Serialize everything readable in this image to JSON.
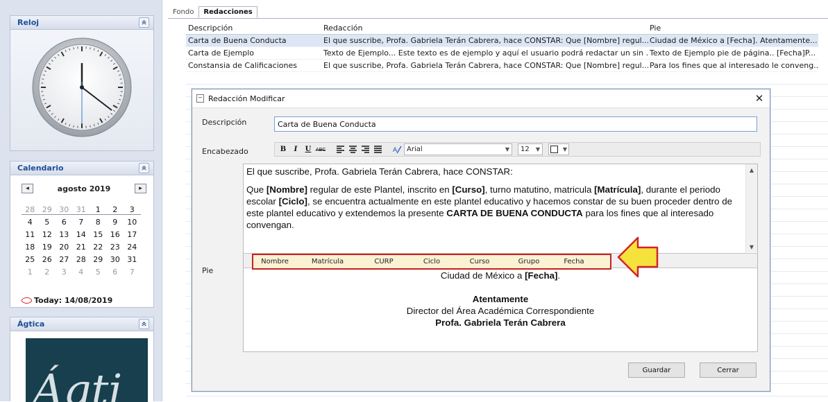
{
  "clock_widget": {
    "title": "Reloj"
  },
  "calendar_widget": {
    "title": "Calendario",
    "month_label": "agosto 2019",
    "weekday_headers": [
      "",
      "",
      "",
      "",
      "",
      "",
      ""
    ],
    "weeks": [
      [
        "28",
        "29",
        "30",
        "31",
        "1",
        "2",
        "3"
      ],
      [
        "4",
        "5",
        "6",
        "7",
        "8",
        "9",
        "10"
      ],
      [
        "11",
        "12",
        "13",
        "14",
        "15",
        "16",
        "17"
      ],
      [
        "18",
        "19",
        "20",
        "21",
        "22",
        "23",
        "24"
      ],
      [
        "25",
        "26",
        "27",
        "28",
        "29",
        "30",
        "31"
      ],
      [
        "1",
        "2",
        "3",
        "4",
        "5",
        "6",
        "7"
      ]
    ],
    "today_label": "Today: 14/08/2019"
  },
  "agtica_widget": {
    "title": "Ágtica",
    "logo_text": "Ágtica"
  },
  "tabs": [
    "Fondo",
    "Redacciones"
  ],
  "grid": {
    "headers": [
      "Descripción",
      "Redacción",
      "Pie"
    ],
    "rows": [
      [
        "Carta de Buena Conducta",
        "El que suscribe, Profa. Gabriela Terán Cabrera, hace CONSTAR: Que [Nombre] regul...",
        "Ciudad de México a [Fecha].  Atentamente..."
      ],
      [
        "Carta de Ejemplo",
        "Texto de Ejemplo...  Este texto es de ejemplo y aquí el usuario podrá redactar un sin ...",
        "Texto de Ejemplo pie de página.. [Fecha]P..."
      ],
      [
        "Constansia de Calificaciones",
        "El que suscribe, Profa. Gabriela Terán Cabrera, hace CONSTAR: Que [Nombre] regul...",
        "Para los fines que al interesado le conveng..."
      ]
    ]
  },
  "dialog": {
    "title": "Redacción Modificar",
    "labels": {
      "descripcion": "Descripción",
      "encabezado": "Encabezado",
      "pie": "Pie"
    },
    "descripcion_value": "Carta de Buena Conducta",
    "toolbar": {
      "bold": "B",
      "italic": "I",
      "underline": "U",
      "strike": "ABC",
      "font": "Arial",
      "size": "12"
    },
    "body": {
      "line1": "El que suscribe, Profa. Gabriela Terán Cabrera, hace CONSTAR:",
      "p2_parts": [
        {
          "t": "Que ",
          "b": false
        },
        {
          "t": "[Nombre]",
          "b": true
        },
        {
          "t": " regular de este Plantel, inscrito en ",
          "b": false
        },
        {
          "t": "[Curso]",
          "b": true
        },
        {
          "t": ", turno matutino, matricula ",
          "b": false
        },
        {
          "t": "[Matrícula]",
          "b": true
        },
        {
          "t": ", durante el periodo escolar ",
          "b": false
        },
        {
          "t": "[Ciclo]",
          "b": true
        },
        {
          "t": ", se encuentra actualmente en este plantel educativo y hacemos constar de su buen proceder dentro de este plantel educativo y extendemos la presente ",
          "b": false
        },
        {
          "t": "CARTA DE BUENA CONDUCTA",
          "b": true
        },
        {
          "t": " para los fines que al interesado convengan.",
          "b": false
        }
      ]
    },
    "fields": [
      "Nombre",
      "Matrícula",
      "CURP",
      "Ciclo",
      "Curso",
      "Grupo",
      "Fecha"
    ],
    "pie": {
      "line1_prefix": "Ciudad de México a ",
      "line1_field": "[Fecha]",
      "line1_suffix": ".",
      "line2": "Atentamente",
      "line3": "Director del Área Académica Correspondiente",
      "line4": "Profa. Gabriela Terán Cabrera"
    },
    "buttons": {
      "save": "Guardar",
      "close": "Cerrar"
    }
  },
  "colors": {
    "widget_title": "#1f4f9a",
    "highlight_border": "#c8201f",
    "callout_arrow": "#f6e23c",
    "selection": "#dde6f5"
  },
  "icons": [
    "collapse-up-icon",
    "clock-icon",
    "prev-month-icon",
    "next-month-icon",
    "close-icon",
    "callout-arrow-icon"
  ]
}
